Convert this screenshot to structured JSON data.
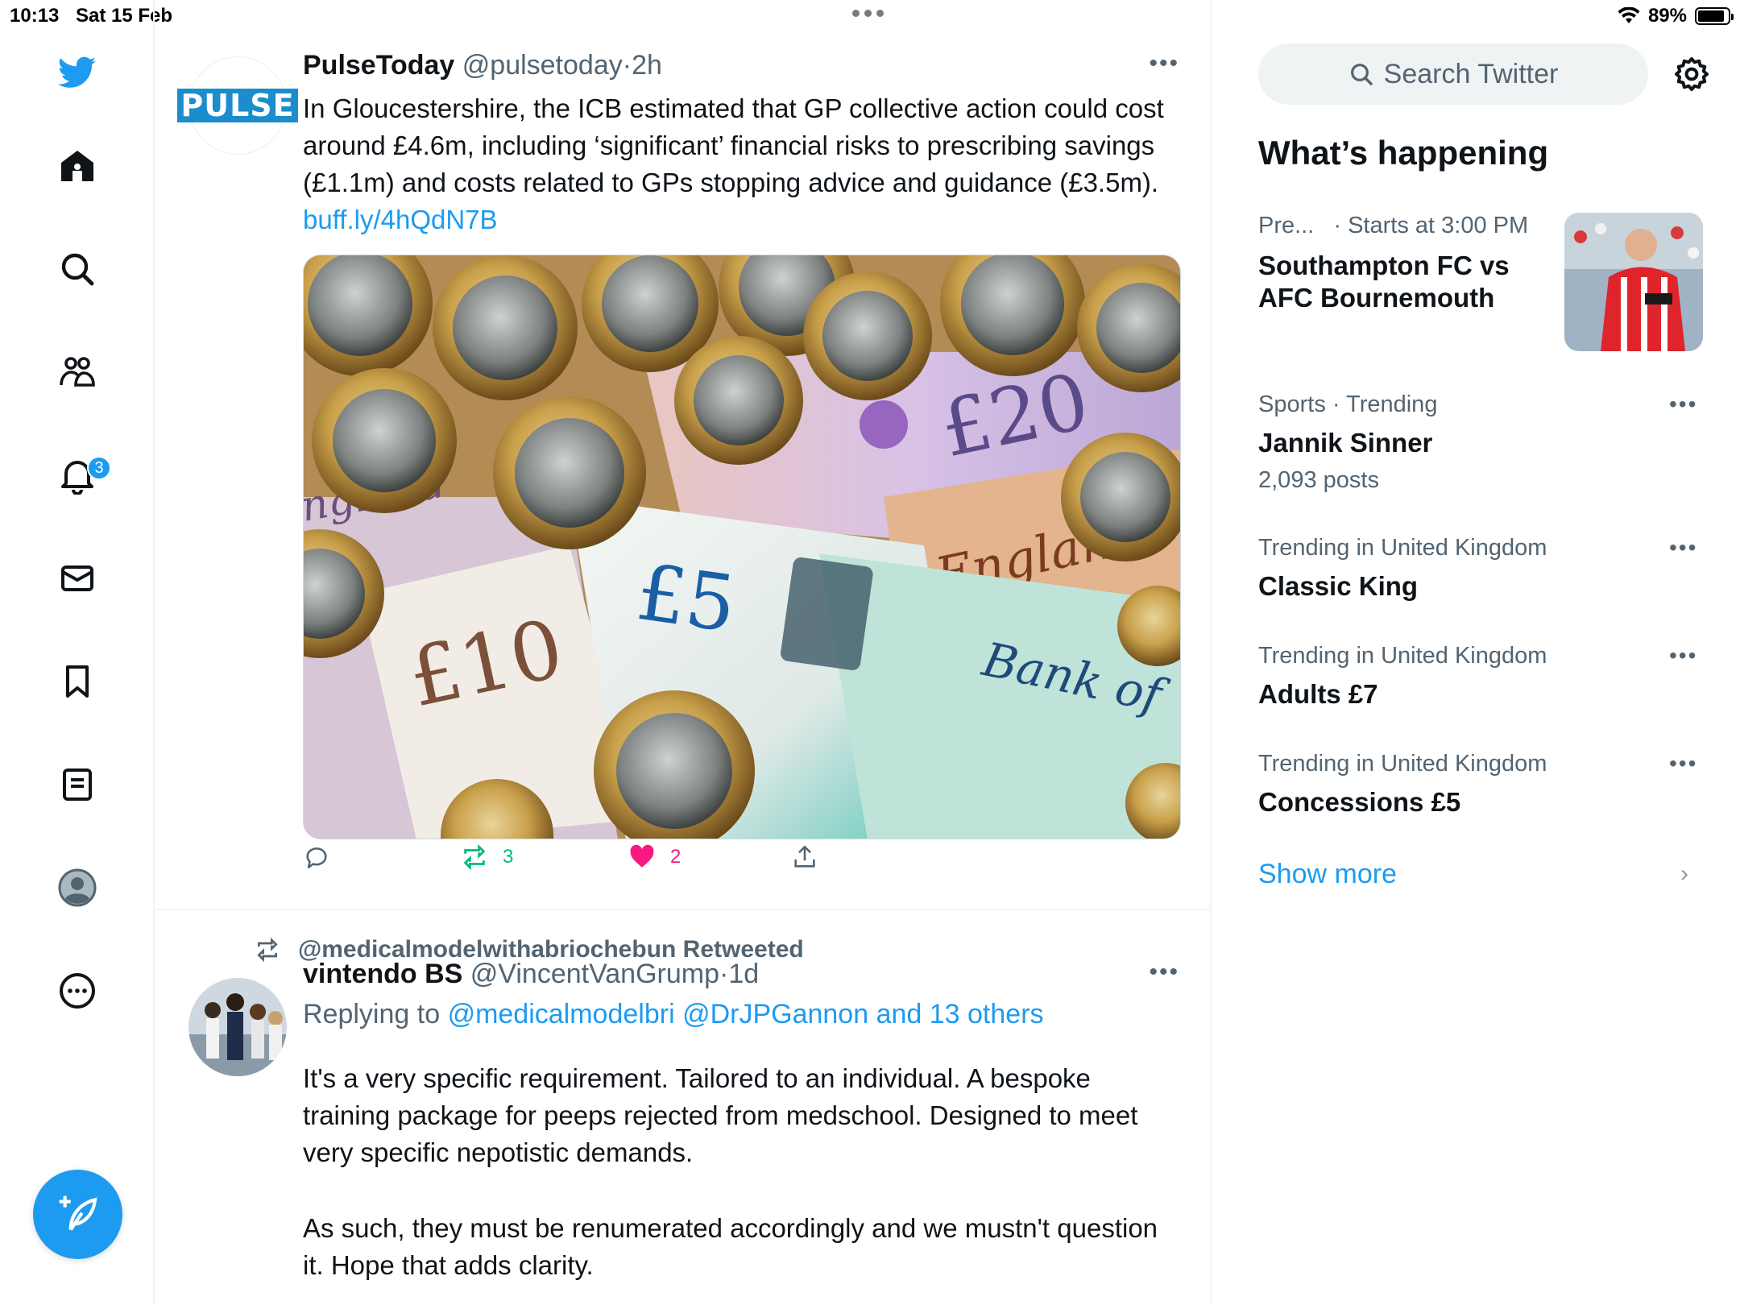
{
  "status_bar": {
    "time": "10:13",
    "date": "Sat 15 Feb",
    "battery": "89%",
    "battery_level": 0.89
  },
  "nav": {
    "items": [
      "twitter-logo",
      "home",
      "search",
      "communities",
      "notifications",
      "messages",
      "bookmarks",
      "lists",
      "profile",
      "more"
    ],
    "notifications_badge": "3"
  },
  "tweet1": {
    "avatar_text": "PULSE",
    "name": "PulseToday",
    "handle": "@pulsetoday",
    "sep": "·",
    "time": "2h",
    "text": "In Gloucestershire, the ICB estimated that GP collective action could cost around £4.6m, including ‘significant’ financial risks to prescribing savings (£1.1m) and costs related to GPs stopping advice and guidance (£3.5m).",
    "link": "buff.ly/4hQdN7B",
    "retweets": "3",
    "likes": "2"
  },
  "tweet2": {
    "retweeted_by": "@medicalmodelwithabriochebun Retweeted",
    "name": "vintendo BS",
    "handle": "@VincentVanGrump",
    "sep": "·",
    "time": "1d",
    "replying_label": "Replying to",
    "replying_to": "@medicalmodelbri @DrJPGannon and 13 others",
    "paragraph1": "It's a very specific requirement. Tailored to an individual. A bespoke training package for peeps rejected from medschool. Designed to meet very specific nepotistic demands.",
    "paragraph2": "As such, they must be renumerated accordingly and we mustn't question it. Hope that adds clarity."
  },
  "sidebar": {
    "search_placeholder": "Search Twitter",
    "heading": "What’s happening",
    "event": {
      "category": "Pre...",
      "time": "· Starts at 3:00 PM",
      "title_line1": "Southampton FC vs",
      "title_line2": "AFC Bournemouth"
    },
    "trends": [
      {
        "meta": "Sports · Trending",
        "title": "Jannik Sinner",
        "count": "2,093 posts"
      },
      {
        "meta": "Trending in United Kingdom",
        "title": "Classic King",
        "count": ""
      },
      {
        "meta": "Trending in United Kingdom",
        "title": "Adults £7",
        "count": ""
      },
      {
        "meta": "Trending in United Kingdom",
        "title": "Concessions £5",
        "count": ""
      }
    ],
    "show_more": "Show more"
  },
  "colors": {
    "accent": "#1d9bf0",
    "retweet": "#00ba7c",
    "like": "#f91880",
    "muted": "#536471"
  }
}
